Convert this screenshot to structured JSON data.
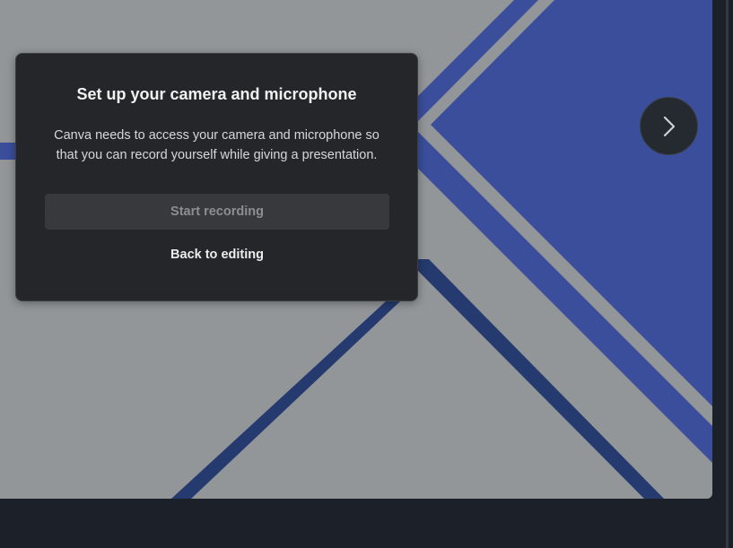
{
  "colors": {
    "app_background": "#1c2028",
    "slide_background": "#939699",
    "slide_accent_blue": "#3a4e9c",
    "slide_navy_stripe": "#253a6e",
    "dialog_background": "#252629",
    "disabled_button_background": "#38393d"
  },
  "dialog": {
    "title": "Set up your camera and microphone",
    "body": "Canva needs to access your camera and microphone so that you can record yourself while giving a presentation.",
    "primary_button_label": "Start recording",
    "primary_button_state": "disabled",
    "secondary_button_label": "Back to editing"
  },
  "navigation": {
    "next_icon": "chevron-right-icon"
  }
}
